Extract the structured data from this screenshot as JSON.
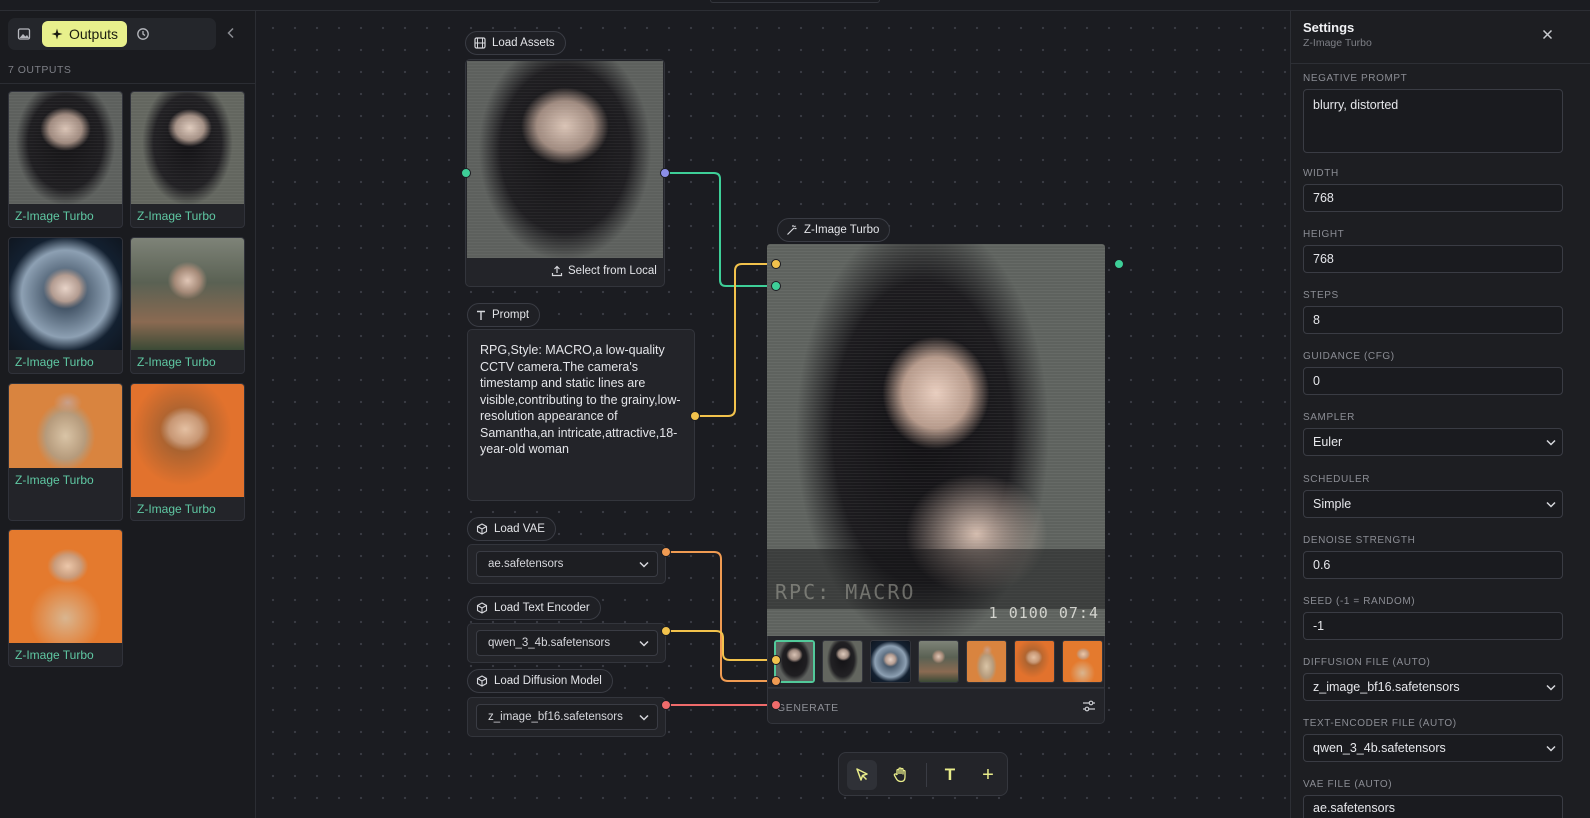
{
  "sidebar": {
    "tabs": {
      "outputs_label": "Outputs"
    },
    "output_count": "7 OUTPUTS",
    "outputs": [
      {
        "caption": "Z-Image Turbo"
      },
      {
        "caption": "Z-Image Turbo"
      },
      {
        "caption": "Z-Image Turbo"
      },
      {
        "caption": "Z-Image Turbo"
      },
      {
        "caption": "Z-Image Turbo"
      },
      {
        "caption": "Z-Image Turbo"
      },
      {
        "caption": "Z-Image Turbo"
      }
    ]
  },
  "canvas": {
    "load_assets": {
      "title": "Load Assets",
      "select_label": "Select from Local"
    },
    "prompt": {
      "title": "Prompt",
      "text": "RPG,Style: MACRO,a low-quality CCTV camera.The camera's timestamp and static lines are visible,contributing to the grainy,low-resolution appearance of Samantha,an intricate,attractive,18-year-old woman"
    },
    "load_vae": {
      "title": "Load VAE",
      "value": "ae.safetensors"
    },
    "load_text_encoder": {
      "title": "Load Text Encoder",
      "value": "qwen_3_4b.safetensors"
    },
    "load_diffusion": {
      "title": "Load Diffusion Model",
      "value": "z_image_bf16.safetensors"
    },
    "zimage": {
      "title": "Z-Image Turbo",
      "overlay_left": "RPC: MACRO",
      "overlay_right": "1 0100 07:4",
      "generate_label": "GENERATE"
    },
    "tools": [
      "select",
      "pan",
      "text",
      "add"
    ],
    "tool_text_glyph": "T",
    "tool_add_glyph": "+"
  },
  "settings": {
    "title": "Settings",
    "subtitle": "Z-Image Turbo",
    "fields": {
      "negative_prompt": {
        "label": "NEGATIVE PROMPT",
        "value": "blurry, distorted"
      },
      "width": {
        "label": "WIDTH",
        "value": "768"
      },
      "height": {
        "label": "HEIGHT",
        "value": "768"
      },
      "steps": {
        "label": "STEPS",
        "value": "8"
      },
      "guidance": {
        "label": "GUIDANCE (CFG)",
        "value": "0"
      },
      "sampler": {
        "label": "SAMPLER",
        "value": "Euler"
      },
      "scheduler": {
        "label": "SCHEDULER",
        "value": "Simple"
      },
      "denoise": {
        "label": "DENOISE STRENGTH",
        "value": "0.6"
      },
      "seed": {
        "label": "SEED (-1 = RANDOM)",
        "value": "-1"
      },
      "diffusion_file": {
        "label": "DIFFUSION FILE (AUTO)",
        "value": "z_image_bf16.safetensors"
      },
      "text_encoder_file": {
        "label": "TEXT-ENCODER FILE (AUTO)",
        "value": "qwen_3_4b.safetensors"
      },
      "vae_file": {
        "label": "VAE FILE (AUTO)",
        "value": "ae.safetensors"
      }
    }
  },
  "colors": {
    "accent": "#e8f08c",
    "caption_green": "#5fc8a3",
    "wire_green": "#3ecf98",
    "wire_yellow": "#f2c24c",
    "wire_orange": "#f09b52",
    "wire_red": "#ef6b6b"
  },
  "icons": [
    "image-icon",
    "sparkles-icon",
    "history-icon",
    "chevron-left-icon",
    "film-icon",
    "upload-icon",
    "text-icon",
    "cube-icon",
    "wand-icon",
    "sliders-icon",
    "close-icon",
    "pointer-icon",
    "hand-icon",
    "plus-icon"
  ]
}
